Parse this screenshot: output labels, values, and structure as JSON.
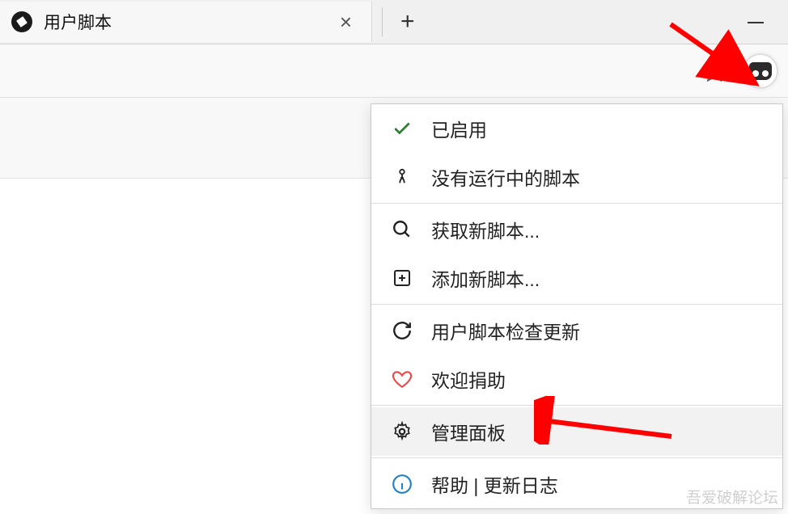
{
  "tab": {
    "title": "用户脚本",
    "close": "×",
    "new": "+"
  },
  "menu": {
    "enabled": "已启用",
    "no_running": "没有运行中的脚本",
    "get_scripts": "获取新脚本...",
    "add_script": "添加新脚本...",
    "check_updates": "用户脚本检查更新",
    "donate": "欢迎捐助",
    "dashboard": "管理面板",
    "help": "帮助 | 更新日志"
  },
  "watermark": "吾爱破解论坛"
}
